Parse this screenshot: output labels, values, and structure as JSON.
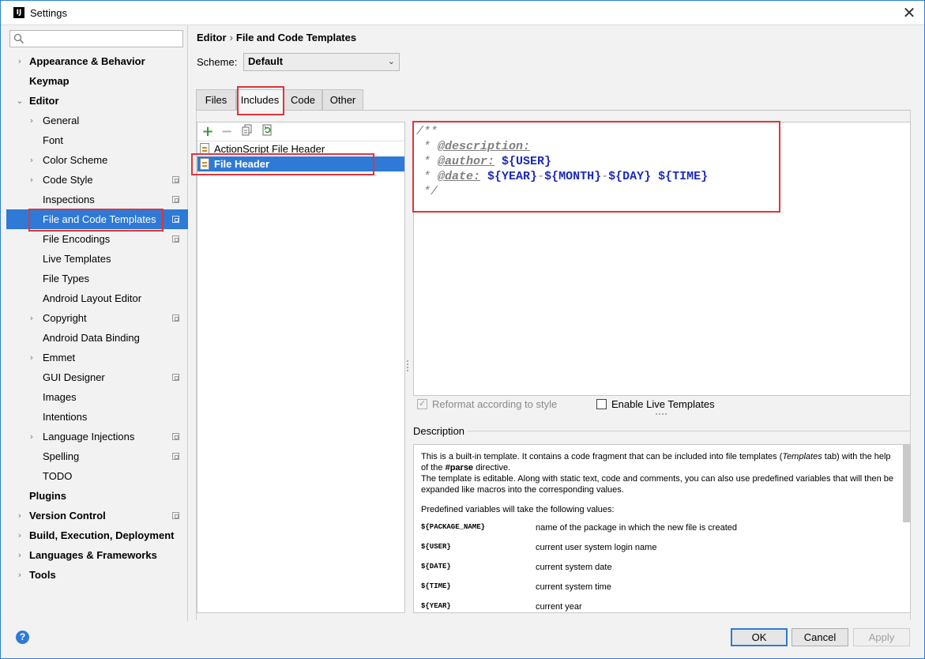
{
  "window": {
    "title": "Settings",
    "app_icon": "IJ"
  },
  "search": {
    "placeholder": ""
  },
  "tree": [
    {
      "label": "Appearance & Behavior",
      "bold": true,
      "arrow": "›",
      "level": 0,
      "gear": false
    },
    {
      "label": "Keymap",
      "bold": true,
      "arrow": "",
      "level": 0,
      "gear": false
    },
    {
      "label": "Editor",
      "bold": true,
      "arrow": "⌄",
      "level": 0,
      "gear": false
    },
    {
      "label": "General",
      "bold": false,
      "arrow": "›",
      "level": 1,
      "gear": false
    },
    {
      "label": "Font",
      "bold": false,
      "arrow": "",
      "level": 1,
      "gear": false
    },
    {
      "label": "Color Scheme",
      "bold": false,
      "arrow": "›",
      "level": 1,
      "gear": false
    },
    {
      "label": "Code Style",
      "bold": false,
      "arrow": "›",
      "level": 1,
      "gear": true
    },
    {
      "label": "Inspections",
      "bold": false,
      "arrow": "",
      "level": 1,
      "gear": true
    },
    {
      "label": "File and Code Templates",
      "bold": false,
      "arrow": "",
      "level": 1,
      "gear": true,
      "selected": true
    },
    {
      "label": "File Encodings",
      "bold": false,
      "arrow": "",
      "level": 1,
      "gear": true
    },
    {
      "label": "Live Templates",
      "bold": false,
      "arrow": "",
      "level": 1,
      "gear": false
    },
    {
      "label": "File Types",
      "bold": false,
      "arrow": "",
      "level": 1,
      "gear": false
    },
    {
      "label": "Android Layout Editor",
      "bold": false,
      "arrow": "",
      "level": 1,
      "gear": false
    },
    {
      "label": "Copyright",
      "bold": false,
      "arrow": "›",
      "level": 1,
      "gear": true
    },
    {
      "label": "Android Data Binding",
      "bold": false,
      "arrow": "",
      "level": 1,
      "gear": false
    },
    {
      "label": "Emmet",
      "bold": false,
      "arrow": "›",
      "level": 1,
      "gear": false
    },
    {
      "label": "GUI Designer",
      "bold": false,
      "arrow": "",
      "level": 1,
      "gear": true
    },
    {
      "label": "Images",
      "bold": false,
      "arrow": "",
      "level": 1,
      "gear": false
    },
    {
      "label": "Intentions",
      "bold": false,
      "arrow": "",
      "level": 1,
      "gear": false
    },
    {
      "label": "Language Injections",
      "bold": false,
      "arrow": "›",
      "level": 1,
      "gear": true
    },
    {
      "label": "Spelling",
      "bold": false,
      "arrow": "",
      "level": 1,
      "gear": true
    },
    {
      "label": "TODO",
      "bold": false,
      "arrow": "",
      "level": 1,
      "gear": false
    },
    {
      "label": "Plugins",
      "bold": true,
      "arrow": "",
      "level": 0,
      "gear": false
    },
    {
      "label": "Version Control",
      "bold": true,
      "arrow": "›",
      "level": 0,
      "gear": true
    },
    {
      "label": "Build, Execution, Deployment",
      "bold": true,
      "arrow": "›",
      "level": 0,
      "gear": false
    },
    {
      "label": "Languages & Frameworks",
      "bold": true,
      "arrow": "›",
      "level": 0,
      "gear": false
    },
    {
      "label": "Tools",
      "bold": true,
      "arrow": "›",
      "level": 0,
      "gear": false
    }
  ],
  "breadcrumb": {
    "parent": "Editor",
    "separator": "›",
    "current": "File and Code Templates"
  },
  "scheme": {
    "label": "Scheme:",
    "value": "Default"
  },
  "tabs": [
    {
      "label": "Files",
      "active": false
    },
    {
      "label": "Includes",
      "active": true
    },
    {
      "label": "Code",
      "active": false
    },
    {
      "label": "Other",
      "active": false
    }
  ],
  "toolbar": {
    "add": "+",
    "remove": "−"
  },
  "templates": [
    {
      "label": "ActionScript File Header",
      "selected": false
    },
    {
      "label": "File Header",
      "selected": true
    }
  ],
  "editor": {
    "line1": "/**",
    "line2_prefix": " * ",
    "line2_tag": "@description:",
    "line3_prefix": " * ",
    "line3_tag": "@author:",
    "line3_var": "${USER}",
    "line4_prefix": " * ",
    "line4_tag": "@date:",
    "line4_year": "${YEAR}",
    "line4_month": "${MONTH}",
    "line4_day": "${DAY}",
    "line4_time": "${TIME}",
    "dash": "-",
    "line5": " */"
  },
  "options": {
    "reformat": {
      "label": "Reformat according to style",
      "checked": true,
      "enabled": false
    },
    "live_templates": {
      "label": "Enable Live Templates",
      "checked": false,
      "enabled": true
    }
  },
  "description": {
    "label": "Description",
    "p1a": "This is a built-in template. It contains a code fragment that can be included into file templates (",
    "p1b": "Templates",
    "p1c": "tab) with the help of the ",
    "p1d": "#parse",
    "p1e": " directive.",
    "p2": "The template is editable. Along with static text, code and comments, you can also use predefined variables that will then be expanded like macros into the corresponding values.",
    "p3": "Predefined variables will take the following values:",
    "vars": [
      {
        "name": "${PACKAGE_NAME}",
        "desc": "name of the package in which the new file is created"
      },
      {
        "name": "${USER}",
        "desc": "current user system login name"
      },
      {
        "name": "${DATE}",
        "desc": "current system date"
      },
      {
        "name": "${TIME}",
        "desc": "current system time"
      },
      {
        "name": "${YEAR}",
        "desc": "current year"
      }
    ]
  },
  "buttons": {
    "help": "?",
    "ok": "OK",
    "cancel": "Cancel",
    "apply": "Apply"
  },
  "colors": {
    "selection": "#2e7ad6",
    "highlight": "#e0353b",
    "variable": "#1b2ab8"
  },
  "icons": {
    "search": "search-icon",
    "copy": "copy-icon",
    "reset": "reset-icon",
    "close": "close-icon",
    "file": "file-template-icon",
    "settings": "settings-gear-icon"
  }
}
